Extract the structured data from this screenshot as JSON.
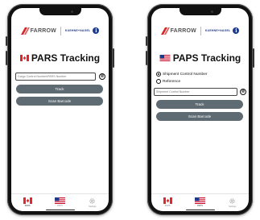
{
  "brand": {
    "farrow": "FARROW",
    "farrow_tagline": "Customs Brokers",
    "kuehne": "KUEHNE+NAGEL",
    "info": "i"
  },
  "left": {
    "title": "PARS Tracking",
    "input_placeholder": "Cargo Control Number/PARS Number",
    "clear": "⊗",
    "track": "Track",
    "scan": "Scan Barcode",
    "tabs": [
      {
        "label": "PARS",
        "icon": "canada-flag-icon"
      },
      {
        "label": "PAPS",
        "icon": "us-flag-icon"
      },
      {
        "label": "Settings",
        "icon": "gear-icon"
      }
    ]
  },
  "right": {
    "title": "PAPS Tracking",
    "radio_shipment": "Shipment Control Number",
    "radio_reference": "Reference",
    "input_placeholder": "Shipment Control Number",
    "clear": "⊗",
    "track": "Track",
    "scan": "Scan Barcode",
    "tabs": [
      {
        "label": "PARS",
        "icon": "canada-flag-icon"
      },
      {
        "label": "PAPS",
        "icon": "us-flag-icon"
      },
      {
        "label": "Settings",
        "icon": "gear-icon"
      }
    ]
  },
  "colors": {
    "button": "#5f6b72",
    "farrow_red": "#d62828",
    "kn_blue": "#1f3a8a",
    "frame": "#111111"
  }
}
